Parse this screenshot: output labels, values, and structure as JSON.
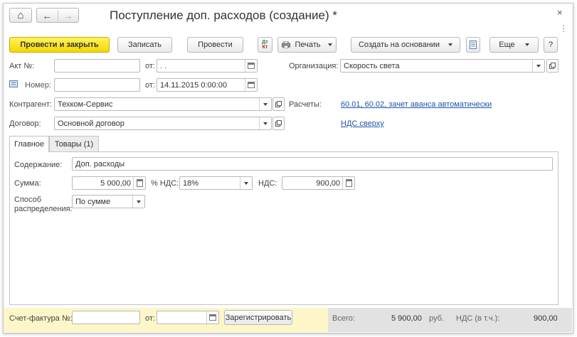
{
  "window": {
    "title": "Поступление доп. расходов (создание) *",
    "close_glyph": "×",
    "menu_glyph": "⋮",
    "nav_home_glyph": "⌂",
    "nav_back_glyph": "←",
    "nav_forward_glyph": "→"
  },
  "toolbar": {
    "post_close": "Провести и закрыть",
    "save": "Записать",
    "post": "Провести",
    "dtkt_top": "Дт",
    "dtkt_bottom": "Кт",
    "print": "Печать",
    "create_based": "Создать на основании",
    "more": "Еще",
    "help": "?"
  },
  "fields": {
    "act_label": "Акт №:",
    "act_value": "",
    "act_from_label": "от:",
    "act_date": " .  .",
    "number_label": "Номер:",
    "number_value": "",
    "number_from_label": "от:",
    "number_date": "14.11.2015  0:00:00",
    "org_label": "Организация:",
    "org_value": "Скорость света",
    "contractor_label": "Контрагент:",
    "contractor_value": "Техком-Сервис",
    "settlements_label": "Расчеты:",
    "settlements_link": "60.01, 60.02, зачет аванса автоматически",
    "contract_label": "Договор:",
    "contract_value": "Основной договор",
    "vat_link": "НДС сверху"
  },
  "tabs": [
    "Главное",
    "Товары (1)"
  ],
  "main_tab": {
    "content_label": "Содержание:",
    "content_value": "Доп. расходы",
    "sum_label": "Сумма:",
    "sum_value": "5 000,00",
    "vat_rate_label": "% НДС:",
    "vat_rate_value": "18%",
    "vat_label": "НДС:",
    "vat_value": "900,00",
    "distribution_label_1": "Способ",
    "distribution_label_2": "распределения:",
    "distribution_value": "По сумме"
  },
  "footer": {
    "invoice_label": "Счет-фактура №:",
    "invoice_value": "",
    "invoice_from_label": "от:",
    "invoice_date": "",
    "register_button": "Зарегистрировать",
    "total_label": "Всего:",
    "total_value": "5 900,00",
    "currency": "руб.",
    "vat_incl_label": "НДС (в т.ч.):",
    "vat_incl_value": "900,00"
  },
  "colors": {
    "primary_button": "#f4d800",
    "link": "#1f55a8",
    "footer_left_bg": "#fdf6c8",
    "footer_right_bg": "#e2e2e2"
  }
}
